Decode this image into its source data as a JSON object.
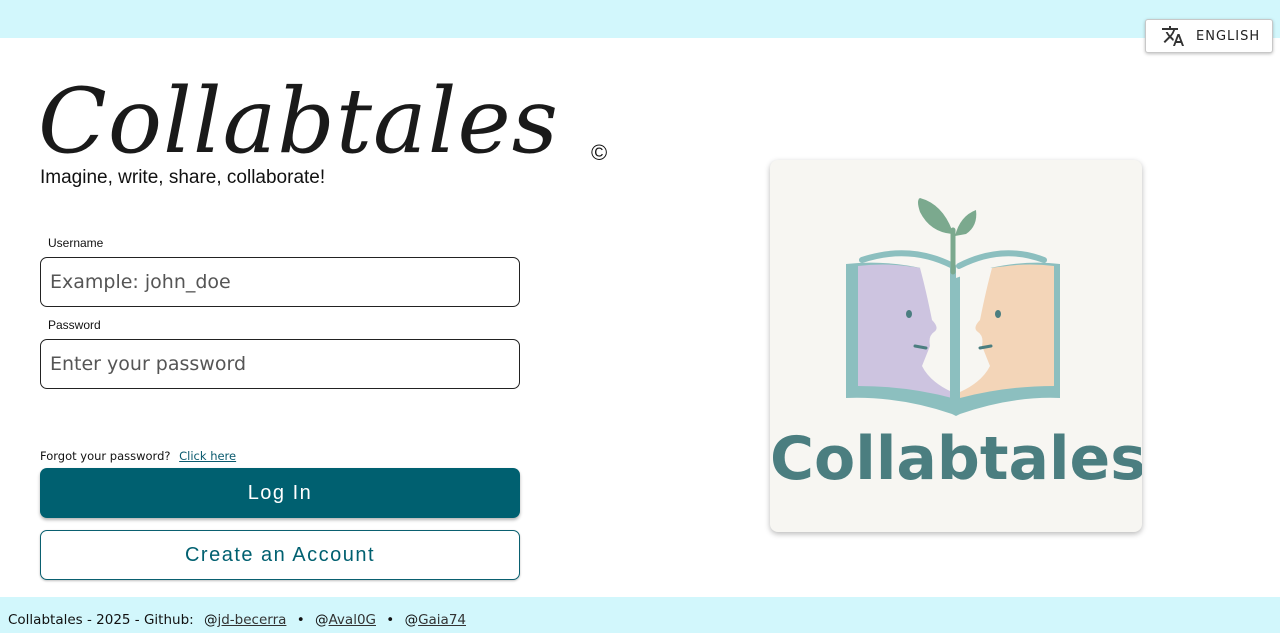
{
  "header": {
    "language_label": "ENGLISH",
    "language_icon": "translate-icon"
  },
  "brand": {
    "title": "Collabtales",
    "copyright": "©",
    "tagline": "Imagine, write, share, collaborate!"
  },
  "login_form": {
    "username_label": "Username",
    "username_placeholder": "Example: john_doe",
    "password_label": "Password",
    "password_placeholder": "Enter your password",
    "forgot_text": "Forgot your password?",
    "forgot_link": "Click here",
    "login_label": "Log In",
    "create_account_label": "Create an Account"
  },
  "logo": {
    "wordmark": "Collabtales",
    "image": "book-with-two-faces-and-sprout-logo"
  },
  "footer": {
    "text": "Collabtales - 2025 - Github:",
    "links": [
      {
        "prefix": "@",
        "handle": "jd-becerra"
      },
      {
        "prefix": "@",
        "handle": "Aval0G"
      },
      {
        "prefix": "@",
        "handle": "Gaia74"
      }
    ],
    "separator": "•"
  },
  "colors": {
    "top_bar": "#d2f7fc",
    "primary": "#006070",
    "logo_text": "#4b7e80"
  }
}
